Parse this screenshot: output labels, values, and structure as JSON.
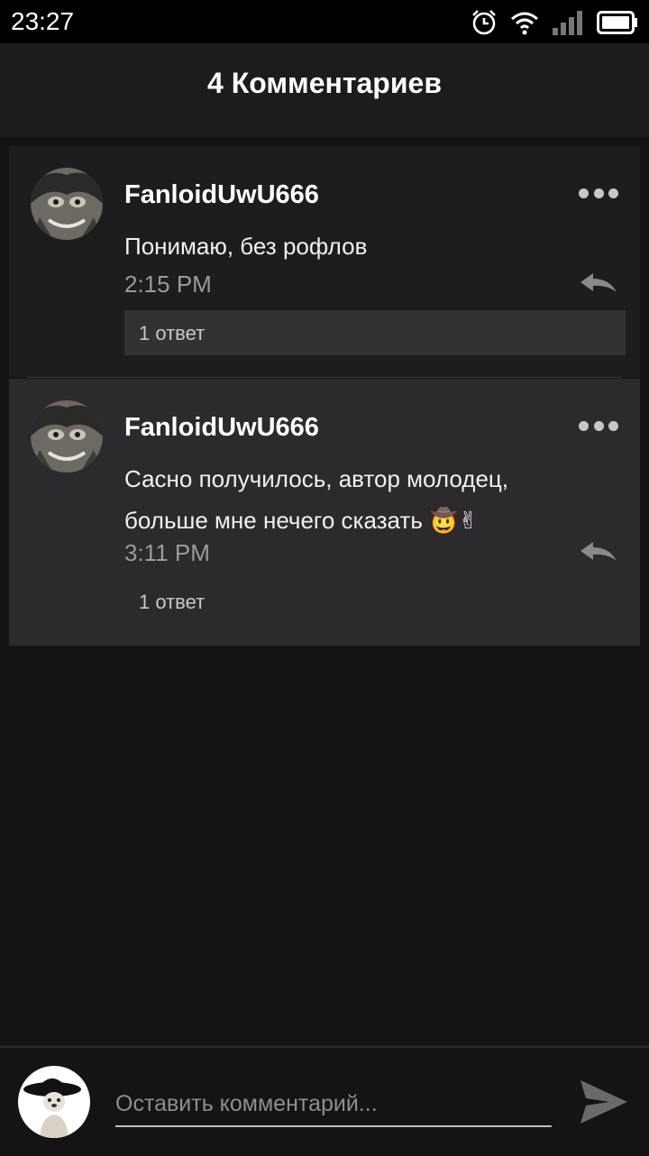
{
  "status_bar": {
    "time": "23:27",
    "icons": [
      "alarm-icon",
      "wifi-icon",
      "signal-icon",
      "battery-icon"
    ]
  },
  "header": {
    "title": "4 Комментариев"
  },
  "comments": [
    {
      "author": "FanloidUwU666",
      "text": "Понимаю, без рофлов",
      "time": "2:15 PM",
      "replies_label": "1 ответ",
      "avatar_icon": "user-avatar"
    },
    {
      "author": "FanloidUwU666",
      "text": "Сасно получилось, автор молодец, больше мне нечего сказать 🤠✌",
      "time": "3:11 PM",
      "replies_label": "1 ответ",
      "avatar_icon": "user-avatar"
    }
  ],
  "composer": {
    "placeholder": "Оставить комментарий...",
    "send_icon": "send-icon",
    "avatar_icon": "current-user-avatar"
  },
  "colors": {
    "background": "#151316",
    "header": "#1d1b1e",
    "comment_bg": "#1e1c1f",
    "comment_highlight_bg": "#2c2a2d",
    "replies_bg": "#333134",
    "muted_text": "#9c9a9c"
  }
}
